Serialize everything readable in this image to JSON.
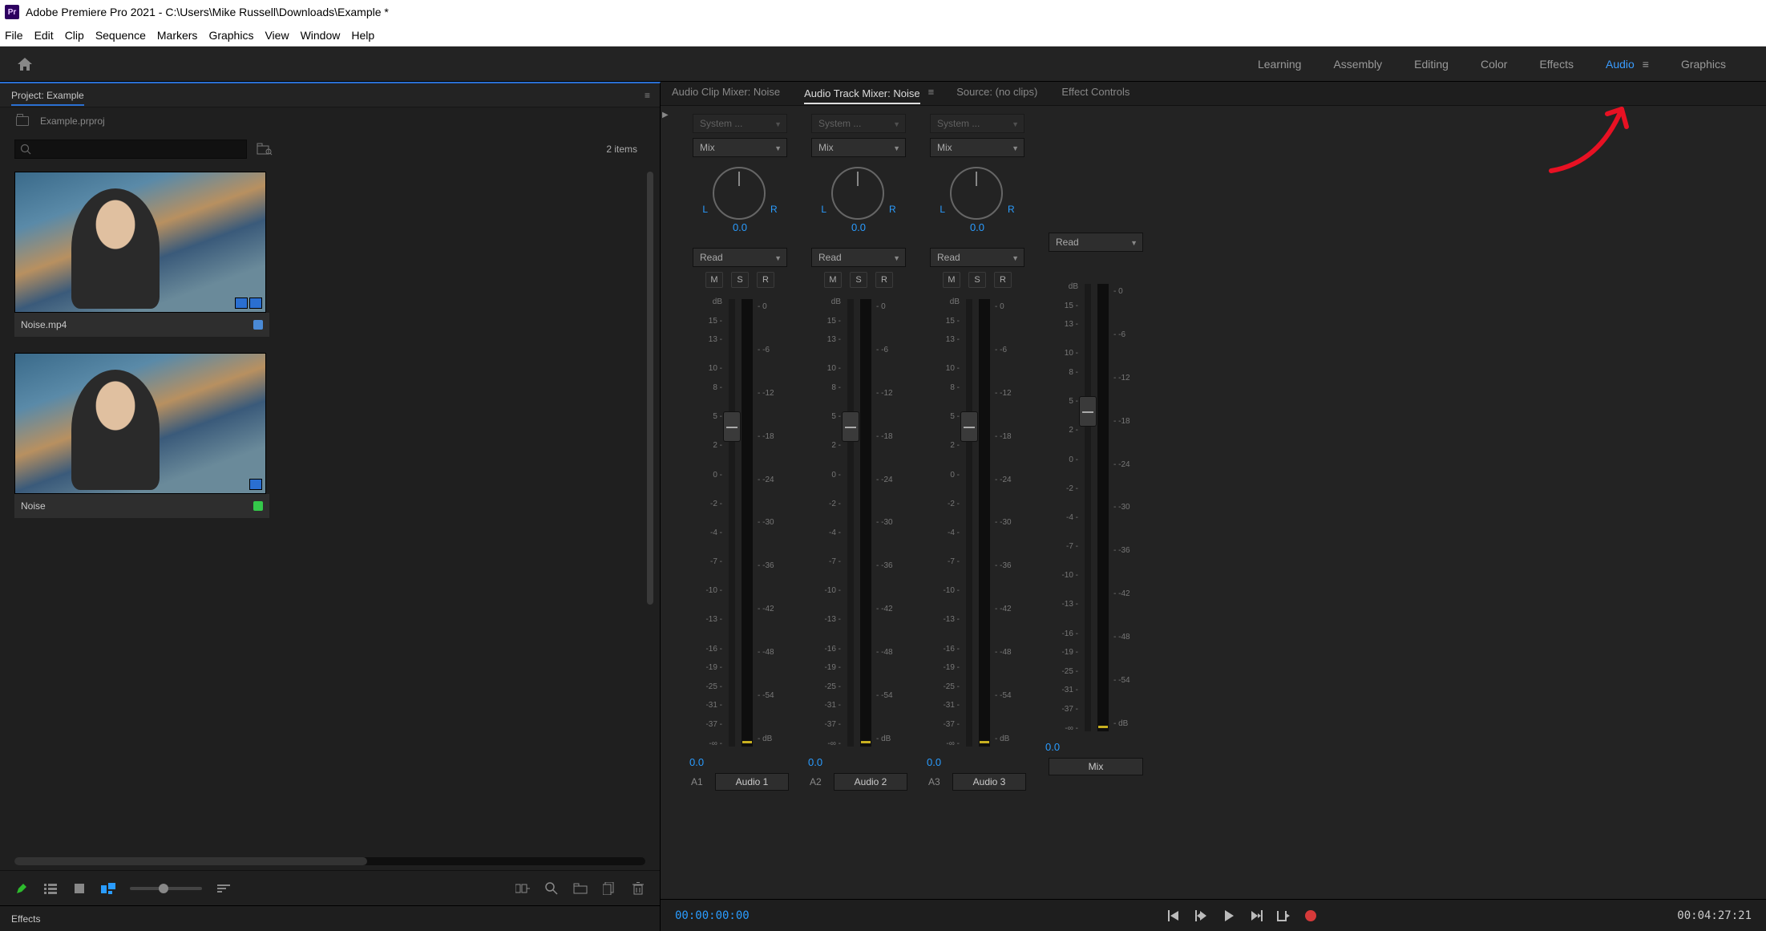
{
  "titlebar": {
    "app": "Adobe Premiere Pro 2021",
    "sep": " - ",
    "path": "C:\\Users\\Mike Russell\\Downloads\\Example *"
  },
  "menu": [
    "File",
    "Edit",
    "Clip",
    "Sequence",
    "Markers",
    "Graphics",
    "View",
    "Window",
    "Help"
  ],
  "workspaces": {
    "items": [
      "Learning",
      "Assembly",
      "Editing",
      "Color",
      "Effects",
      "Audio",
      "Graphics"
    ],
    "active": "Audio"
  },
  "project": {
    "panel_title": "Project: Example",
    "file": "Example.prproj",
    "item_count": "2 items",
    "clips": [
      {
        "name": "Noise.mp4",
        "badge_color": "blue"
      },
      {
        "name": "Noise",
        "badge_color": "green"
      }
    ]
  },
  "effects_panel": {
    "title": "Effects"
  },
  "source_tabs": {
    "items": [
      "Audio Clip Mixer: Noise",
      "Audio Track Mixer: Noise",
      "Source: (no clips)",
      "Effect Controls"
    ],
    "active": "Audio Track Mixer: Noise"
  },
  "mixer": {
    "system_label": "System ...",
    "mix_label": "Mix",
    "read_label": "Read",
    "L": "L",
    "R": "R",
    "pan_value": "0.0",
    "msr": [
      "M",
      "S",
      "R"
    ],
    "fader_scale": [
      "dB",
      "15 -",
      "13 -",
      "",
      "10 -",
      "8 -",
      "",
      "5 -",
      "",
      "2 -",
      "",
      "0 -",
      "",
      "-2 -",
      "",
      "-4 -",
      "",
      "-7 -",
      "",
      "-10 -",
      "",
      "-13 -",
      "",
      "-16 -",
      "-19 -",
      "-25 -",
      "-31 -",
      "-37 -",
      "-∞ -"
    ],
    "meter_scale": [
      "- 0",
      "",
      "- -6",
      "",
      "- -12",
      "",
      "- -18",
      "",
      "- -24",
      "",
      "- -30",
      "",
      "- -36",
      "",
      "- -42",
      "",
      "- -48",
      "",
      "- -54",
      "",
      "- dB"
    ],
    "fader_value": "0.0",
    "tracks": [
      {
        "id": "A1",
        "name": "Audio 1"
      },
      {
        "id": "A2",
        "name": "Audio 2"
      },
      {
        "id": "A3",
        "name": "Audio 3"
      }
    ],
    "mix_track": {
      "name": "Mix"
    }
  },
  "timeline": {
    "current": "00:00:00:00",
    "duration": "00:04:27:21"
  }
}
